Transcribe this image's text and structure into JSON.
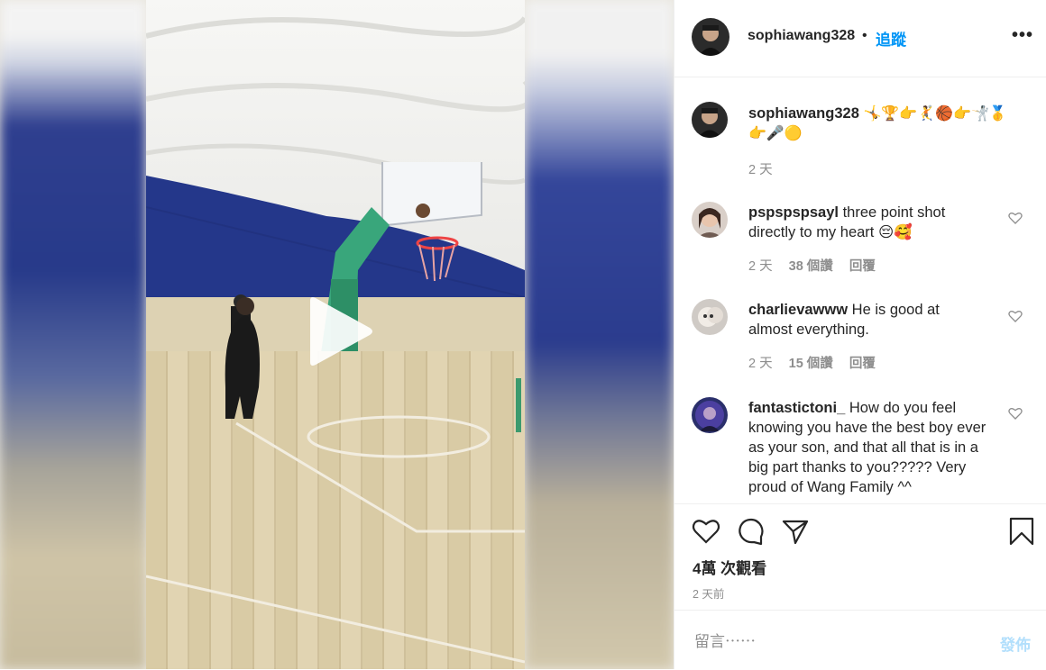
{
  "post": {
    "username": "sophiawang328",
    "separator": "•",
    "follow_label": "追蹤",
    "more_label": "•••"
  },
  "caption": {
    "username": "sophiawang328",
    "text": "🤸🏆👉🤾🏀👉🤺🥇👉🎤🟡",
    "time": "2 天"
  },
  "comments": [
    {
      "username": "pspspspsayl",
      "text": "three point shot directly to my heart 😔🥰",
      "time": "2 天",
      "likes": "38 個讚",
      "reply": "回覆"
    },
    {
      "username": "charlievawww",
      "text": "He is good at almost everything.",
      "time": "2 天",
      "likes": "15 個讚",
      "reply": "回覆"
    },
    {
      "username": "fantastictoni_",
      "text": "How do you feel knowing you have the best boy ever as your son, and that all that is in a big part thanks to you????? Very proud of Wang Family ^^"
    }
  ],
  "stats": {
    "views": "4萬 次觀看",
    "date": "2 天前"
  },
  "compose": {
    "placeholder": "留言⋯⋯",
    "post_label": "發佈"
  },
  "icons": {
    "like": "heart-icon",
    "comment": "comment-icon",
    "share": "paper-plane-icon",
    "save": "bookmark-icon",
    "play": "play-icon"
  }
}
